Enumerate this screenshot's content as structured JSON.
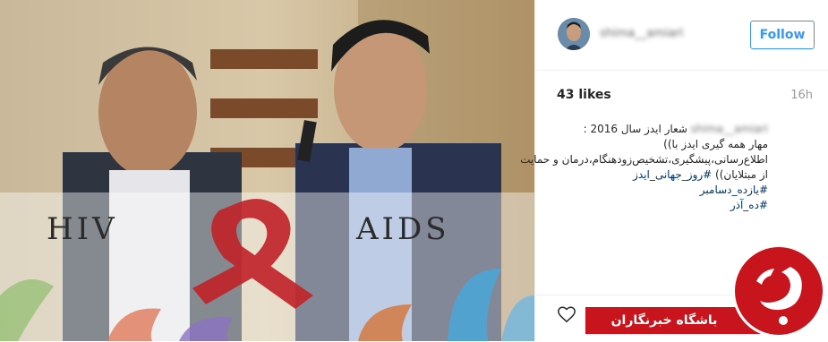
{
  "post": {
    "image_text_left": "HIV",
    "image_text_right": "AIDS",
    "image_description_icon": "ribbon-icon"
  },
  "header": {
    "username": "shima__amiari",
    "follow_label": "Follow"
  },
  "stats": {
    "likes": "43 likes",
    "time": "16h"
  },
  "caption": {
    "user": "shima__amiari",
    "line1": "شعار ایدز سال 2016 :",
    "line2": "مهار همه گیری ایدز با))",
    "line3": "اطلاع‌رسانی،پیشگیری،تشخیص‌زودهنگام،درمان و حمایت",
    "line4_text": "از مبتلایان))",
    "line4_tag": "#روز_جهانی_ایدز",
    "tag2": "#یازده_دسامبر",
    "tag3": "#ده_آذر"
  },
  "watermark": {
    "label": "باشگاه خبرنگاران",
    "logo_icon": "yjc-logo-icon"
  },
  "colors": {
    "accent": "#3897f0",
    "watermark": "#c8141c",
    "hashtag": "#003569"
  }
}
